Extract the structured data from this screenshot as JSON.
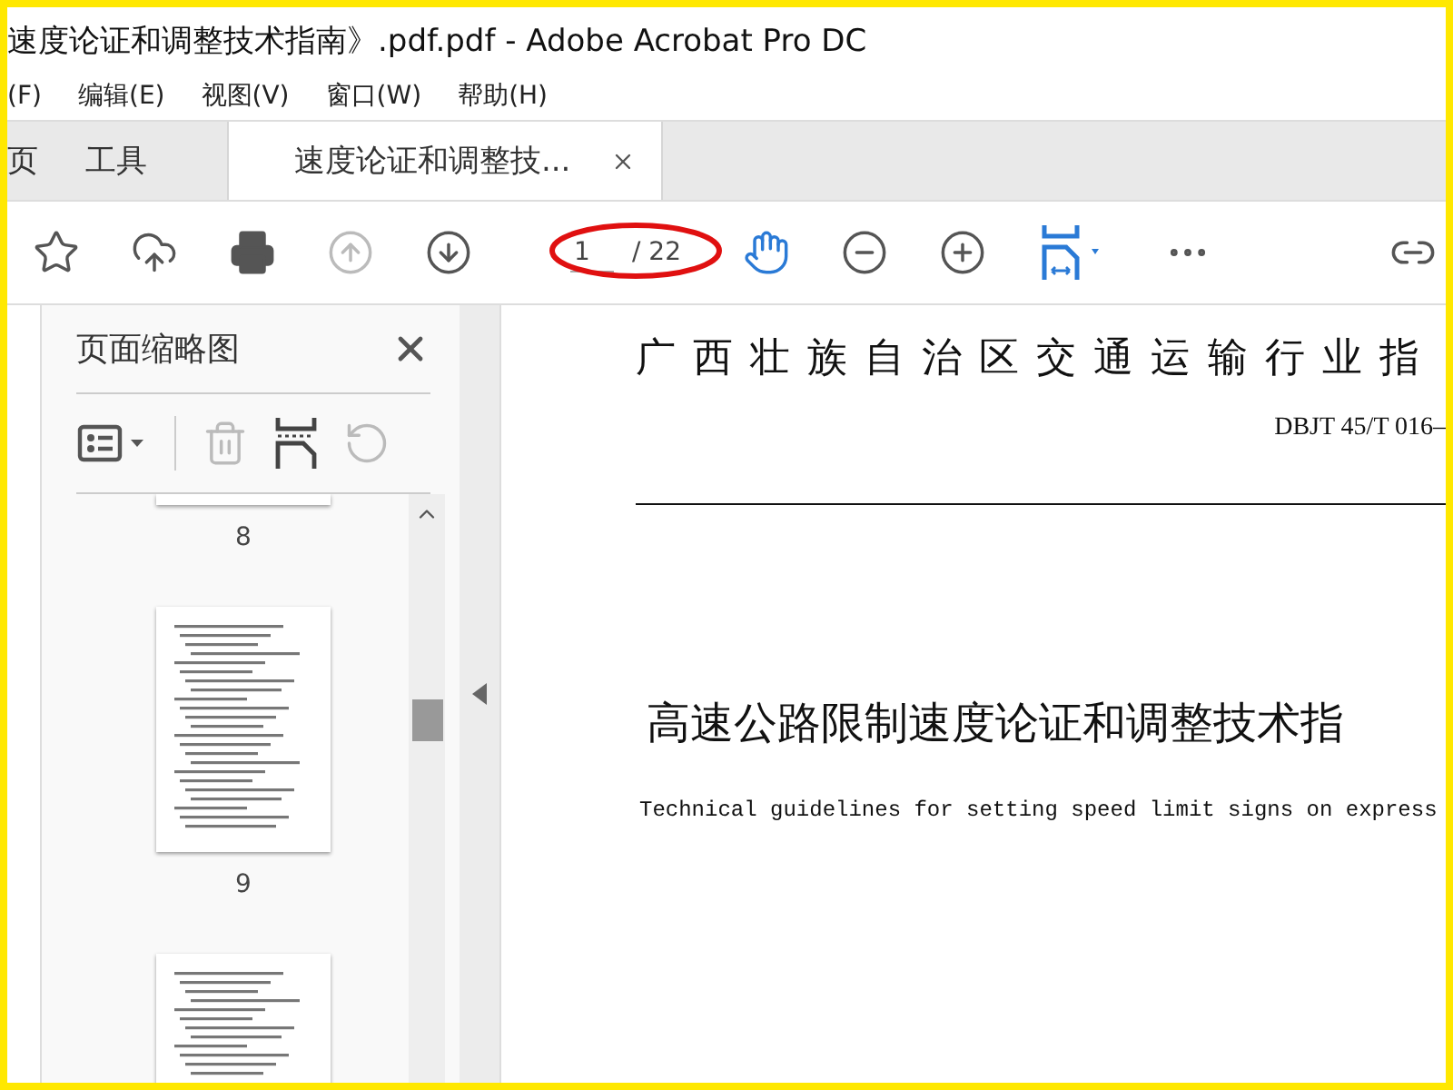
{
  "window": {
    "title": "速度论证和调整技术指南》.pdf.pdf - Adobe Acrobat Pro DC"
  },
  "menu": [
    "(F)",
    "编辑(E)",
    "视图(V)",
    "窗口(W)",
    "帮助(H)"
  ],
  "tabs": [
    {
      "label": "页",
      "selected": false,
      "closable": false
    },
    {
      "label": "工具",
      "selected": false,
      "closable": false
    },
    {
      "label": "速度论证和调整技...",
      "selected": true,
      "closable": true
    }
  ],
  "toolbar": {
    "page_value": "1",
    "page_total": "/ 22",
    "hand_tool_on": true
  },
  "thumbnails_panel": {
    "title": "页面缩略图",
    "pages": [
      {
        "label": "8",
        "kind": "tail"
      },
      {
        "label": "9",
        "kind": "whole"
      },
      {
        "kind": "head"
      }
    ]
  },
  "document": {
    "authority": "广西壮族自治区交通运输行业指",
    "code": "DBJT 45/T 016–",
    "title": "高速公路限制速度论证和调整技术指",
    "subtitle": "Technical guidelines for setting speed limit signs on express"
  }
}
